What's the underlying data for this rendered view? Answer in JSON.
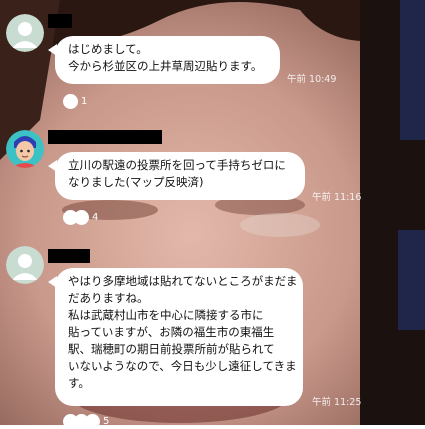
{
  "colors": {
    "background_skin": "#c9998b",
    "avatar_default": "#c9dcd2",
    "bubble": "#ffffff",
    "name_redaction": "#000000",
    "timestamp": "#e8e8e8"
  },
  "messages": [
    {
      "avatar": "default-person-icon",
      "lines": [
        "はじめまして。",
        "今から杉並区の上井草周辺貼ります。"
      ],
      "time": "午前 10:49",
      "reactions": {
        "icons": [
          "surprised-face-icon"
        ],
        "count": "1"
      }
    },
    {
      "avatar": "cartoon-avatar-icon",
      "lines": [
        "立川の駅遠の投票所を回って手持ちゼロに",
        "なりました(マップ反映済)"
      ],
      "time": "午前 11:16",
      "reactions": {
        "icons": [
          "surprised-face-icon",
          "heart-face-icon"
        ],
        "count": "4"
      }
    },
    {
      "avatar": "default-person-icon",
      "lines": [
        "やはり多摩地域は貼れてないところがまだま",
        "だありますね。",
        "私は武蔵村山市を中心に隣接する市に",
        "貼っていますが、お隣の福生市の東福生",
        "駅、瑞穂町の期日前投票所前が貼られて",
        "いないようなので、今日も少し遠征してきま",
        "す。"
      ],
      "time": "午前 11:25",
      "reactions": {
        "icons": [
          "surprised-face-icon",
          "heart-face-icon",
          "laughing-face-icon"
        ],
        "count": "5"
      }
    }
  ]
}
